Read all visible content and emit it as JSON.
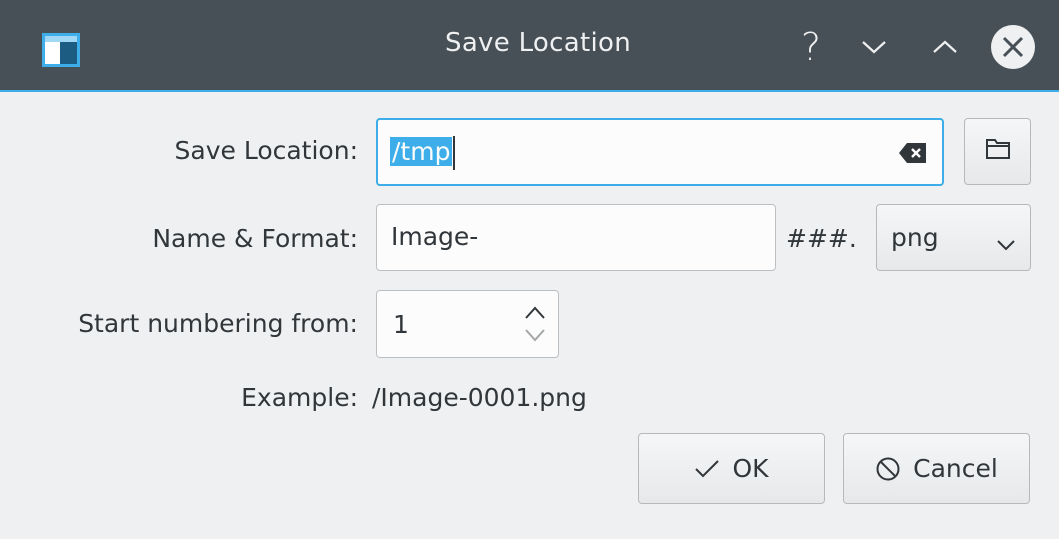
{
  "window": {
    "title": "Save Location",
    "controls": [
      "help-icon",
      "minimize-icon",
      "maximize-icon",
      "close-icon"
    ],
    "help_glyph": "?"
  },
  "form": {
    "save_location": {
      "label": "Save Location:",
      "value": "/tmp"
    },
    "name_format": {
      "label": "Name & Format:",
      "value": "Image-",
      "suffix": "###.",
      "format": "png"
    },
    "start_numbering": {
      "label": "Start numbering from:",
      "value": "1"
    },
    "example": {
      "label": "Example:",
      "value": "/Image-0001.png"
    }
  },
  "buttons": {
    "ok": "OK",
    "cancel": "Cancel"
  },
  "colors": {
    "titlebar": "#475057",
    "accent": "#3daee9",
    "background": "#eff0f1"
  }
}
